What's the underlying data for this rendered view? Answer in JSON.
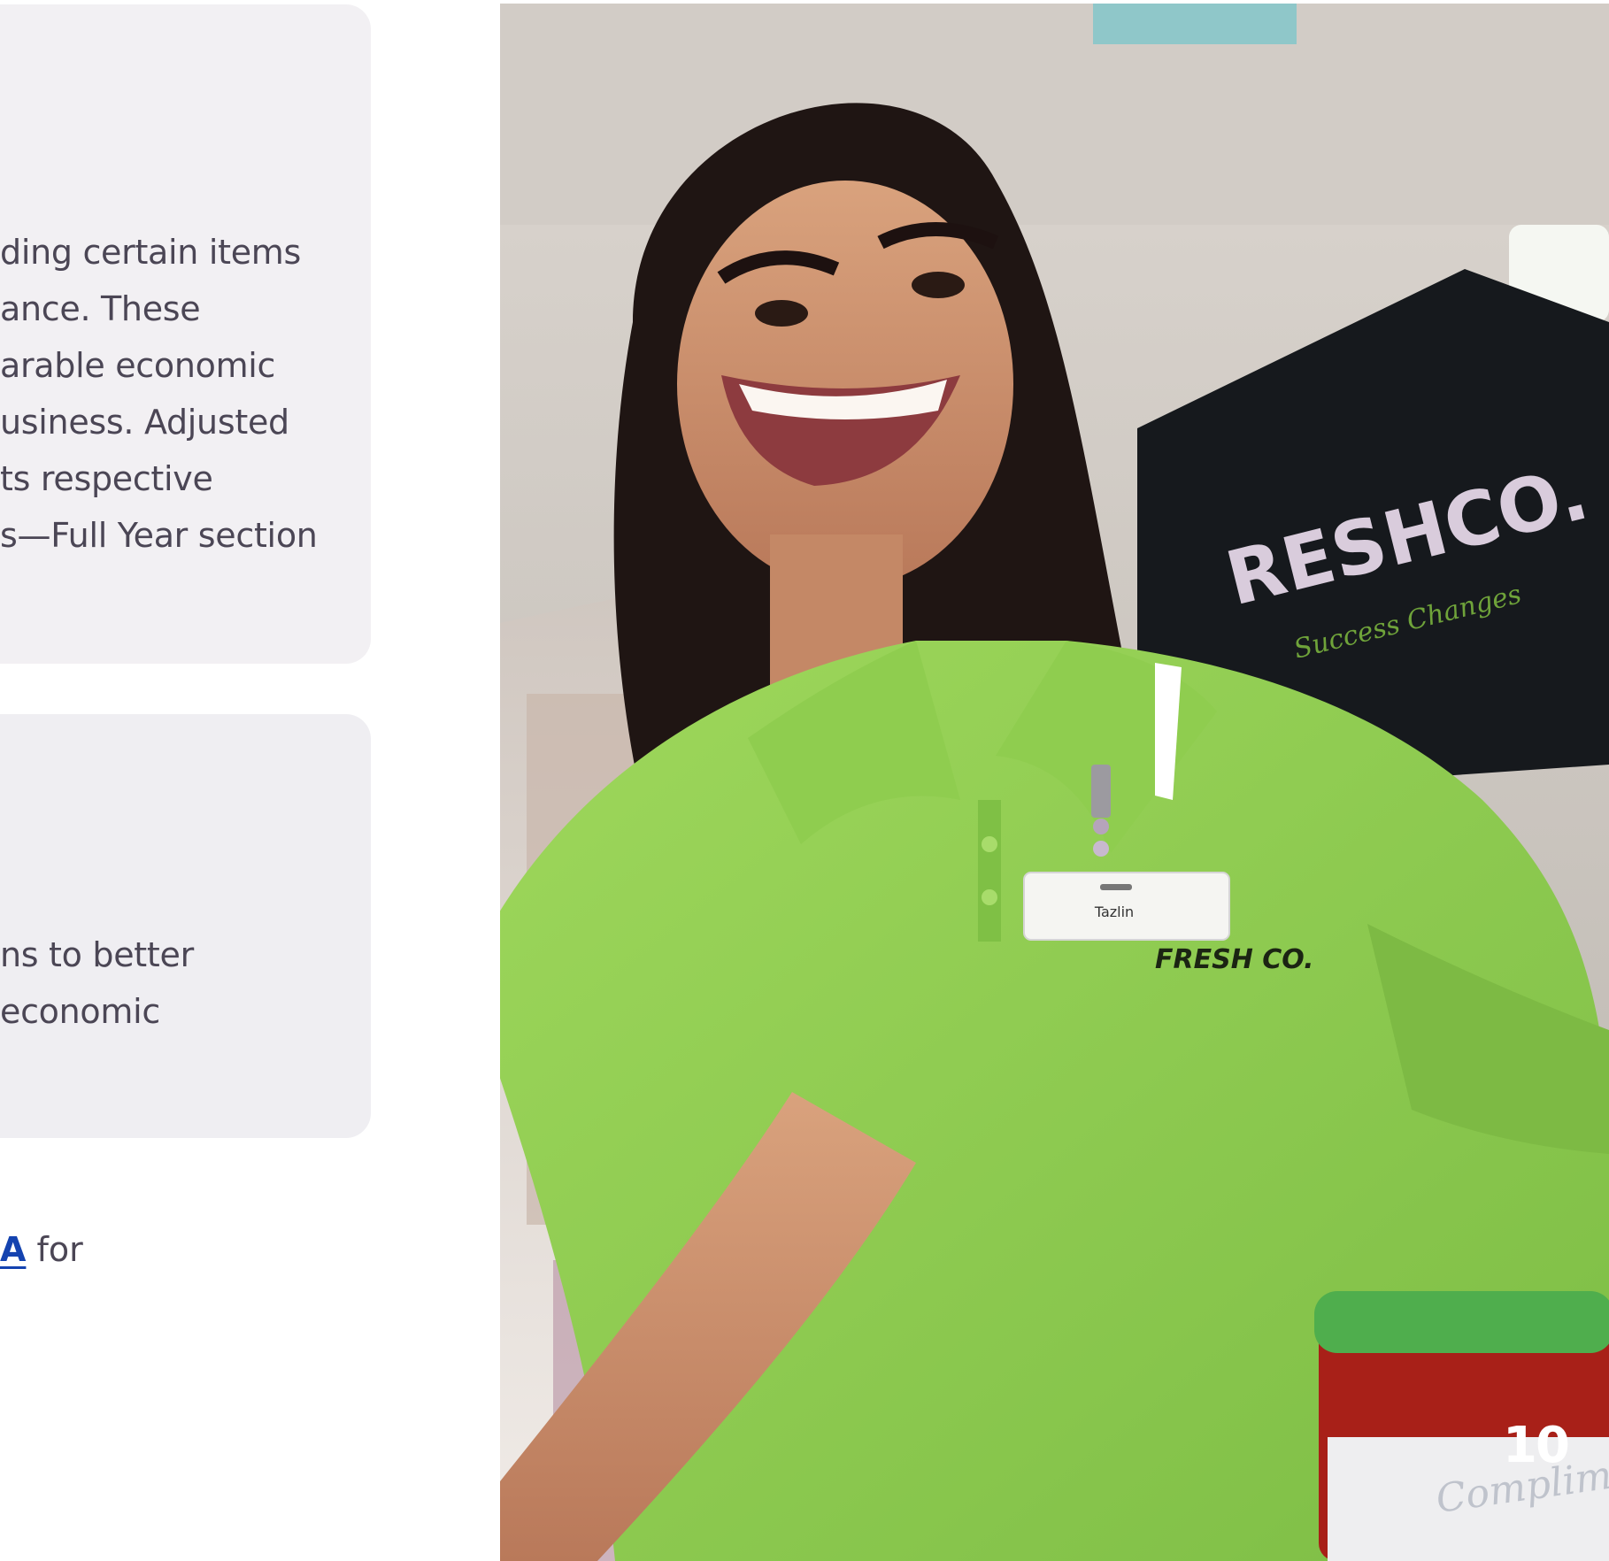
{
  "panel_top": {
    "lines": [
      "ding certain items",
      "ance. These",
      "arable economic",
      "usiness. Adjusted",
      "ts respective",
      "s—Full Year section"
    ]
  },
  "panel_bottom": {
    "lines": [
      "ns to better",
      "economic"
    ]
  },
  "footnote": {
    "link_text": "A",
    "trailing_text": " for"
  },
  "photo": {
    "nametag": "Tazlin",
    "shirt_logo": "FRESH CO.",
    "sign_text": "RESHCO.",
    "sign_tagline": "Success Changes",
    "jar_label": "Compliments"
  },
  "page_number": "10",
  "colors": {
    "panel_bg": "#f2f0f3",
    "body_text": "#4b4655",
    "link": "#1443b0",
    "shirt": "#8ccd4e"
  }
}
